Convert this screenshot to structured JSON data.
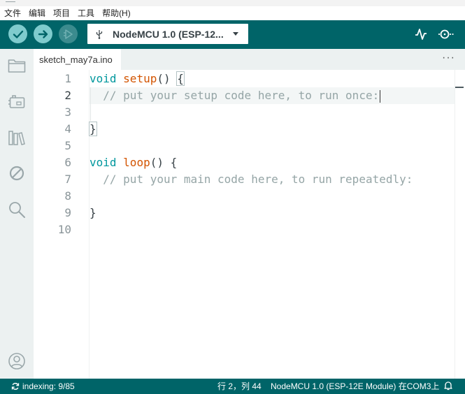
{
  "menu": [
    "文件",
    "编辑",
    "项目",
    "工具",
    "帮助(H)"
  ],
  "toolbar": {
    "board_name": "NodeMCU 1.0 (ESP-12..."
  },
  "tabs": [
    {
      "label": "sketch_may7a.ino"
    }
  ],
  "tab_more": "···",
  "editor": {
    "lines": [
      {
        "num": "1"
      },
      {
        "num": "2"
      },
      {
        "num": "3"
      },
      {
        "num": "4"
      },
      {
        "num": "5"
      },
      {
        "num": "6"
      },
      {
        "num": "7"
      },
      {
        "num": "8"
      },
      {
        "num": "9"
      },
      {
        "num": "10"
      }
    ],
    "code": {
      "l1_kw": "void",
      "l1_fn": "setup",
      "l1_rest": "() ",
      "l1_brace": "{",
      "l2_comment": "  // put your setup code here, to run once:",
      "l4_brace": "}",
      "l6_kw": "void",
      "l6_fn": "loop",
      "l6_rest": "() {",
      "l7_comment": "  // put your main code here, to run repeatedly:",
      "l9_brace": "}"
    }
  },
  "status": {
    "indexing": "indexing: 9/85",
    "position": "行 2，列 44",
    "board_port": "NodeMCU 1.0 (ESP-12E Module) 在COM3上"
  },
  "colors": {
    "toolbar_bg": "#006468",
    "keyword": "#00979d",
    "function": "#d35400",
    "comment": "#95a5a6"
  }
}
